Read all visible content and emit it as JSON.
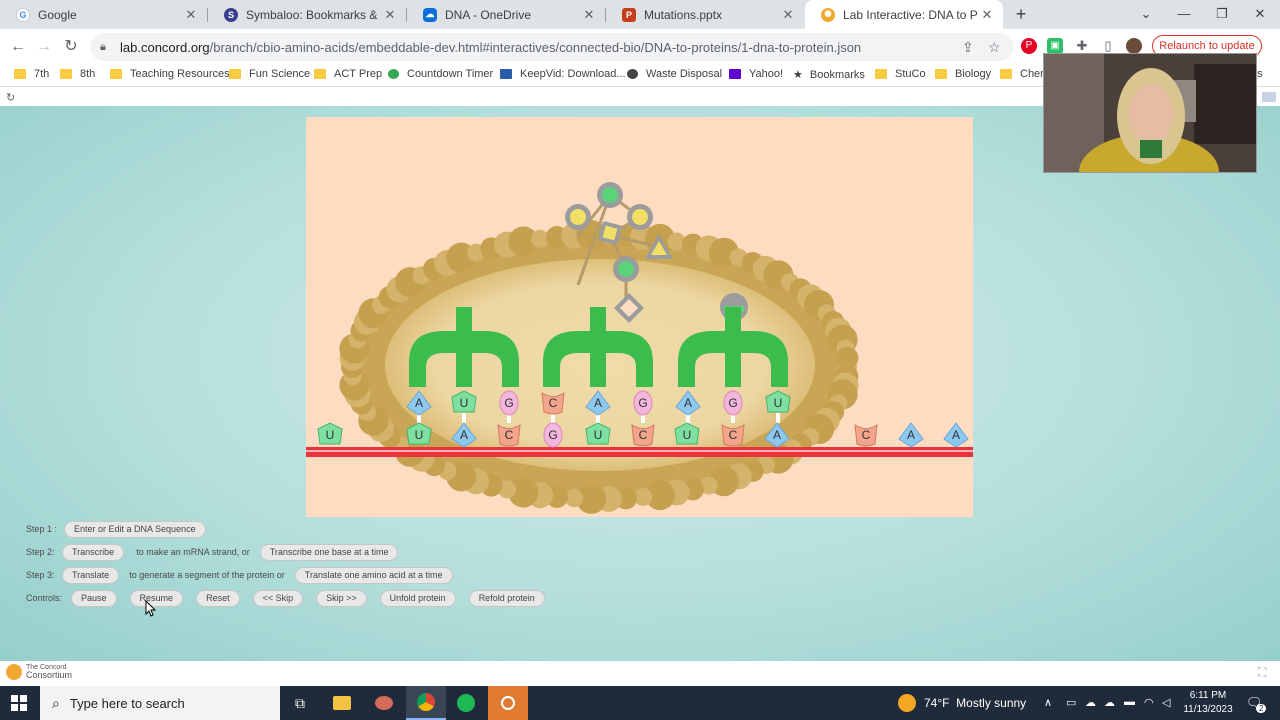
{
  "browser": {
    "tabs": [
      {
        "title": "Google",
        "icon": "google-icon",
        "active": false
      },
      {
        "title": "Symbaloo: Bookmarks & Favorit",
        "icon": "symbaloo-icon",
        "active": false
      },
      {
        "title": "DNA - OneDrive",
        "icon": "onedrive-icon",
        "active": false
      },
      {
        "title": "Mutations.pptx",
        "icon": "powerpoint-icon",
        "active": false
      },
      {
        "title": "Lab Interactive: DNA to Protein",
        "icon": "concord-icon",
        "active": true
      }
    ],
    "url_host": "lab.concord.org",
    "url_path": "/branch/cbio-amino-acids/embeddable-dev.html#interactives/connected-bio/DNA-to-proteins/1-dna-to-protein.json",
    "relaunch_label": "Relaunch to update",
    "bookmarks": [
      {
        "label": "7th",
        "type": "folder"
      },
      {
        "label": "8th",
        "type": "folder"
      },
      {
        "label": "Teaching Resources",
        "type": "folder"
      },
      {
        "label": "Fun Science",
        "type": "folder"
      },
      {
        "label": "ACT Prep",
        "type": "folder"
      },
      {
        "label": "Countdown Timer",
        "type": "link"
      },
      {
        "label": "KeepVid: Download...",
        "type": "link"
      },
      {
        "label": "Waste Disposal",
        "type": "link"
      },
      {
        "label": "Yahoo!",
        "type": "link"
      },
      {
        "label": "Bookmarks",
        "type": "link"
      },
      {
        "label": "StuCo",
        "type": "folder"
      },
      {
        "label": "Biology",
        "type": "folder"
      },
      {
        "label": "Chem",
        "type": "folder"
      },
      {
        "label": "rks",
        "type": "folder"
      }
    ]
  },
  "simulation": {
    "mrna_bases": [
      "U",
      "A",
      "C",
      "G",
      "U",
      "C",
      "U",
      "C",
      "A"
    ],
    "trna_anticodons": [
      [
        "A",
        "U",
        "G"
      ],
      [
        "C",
        "A",
        "G"
      ],
      [
        "A",
        "G",
        "U"
      ]
    ],
    "free_bases": [
      "U",
      "C",
      "A",
      "A"
    ],
    "colors": {
      "U": "#7ee0a0",
      "A": "#8cc8f0",
      "C": "#f2a58a",
      "G": "#f3b6dd",
      "trna": "#3cbc4c",
      "mrna": "#e8323c",
      "ribosome": "#d2b064"
    }
  },
  "controls": {
    "step1_label": "Step 1 :",
    "step1_button": "Enter or Edit a DNA Sequence",
    "step2_label": "Step 2:",
    "step2_button": "Transcribe",
    "step2_text": "to make an mRNA strand, or",
    "step2_button2": "Transcribe one base at a time",
    "step3_label": "Step 3:",
    "step3_button": "Translate",
    "step3_text": "to generate a segment of the protein or",
    "step3_button2": "Translate one amino acid at a time",
    "controls_label": "Controls:",
    "pause": "Pause",
    "resume": "Resume",
    "reset": "Reset",
    "skip_back": "<< Skip",
    "skip_fwd": "Skip >>",
    "unfold": "Unfold protein",
    "refold": "Refold protein"
  },
  "footer": {
    "brand_line1": "The Concord",
    "brand_line2": "Consortium"
  },
  "taskbar": {
    "search_placeholder": "Type here to search",
    "weather": "74°F  Mostly sunny",
    "time": "6:11 PM",
    "date": "11/13/2023",
    "notification_count": "2"
  }
}
